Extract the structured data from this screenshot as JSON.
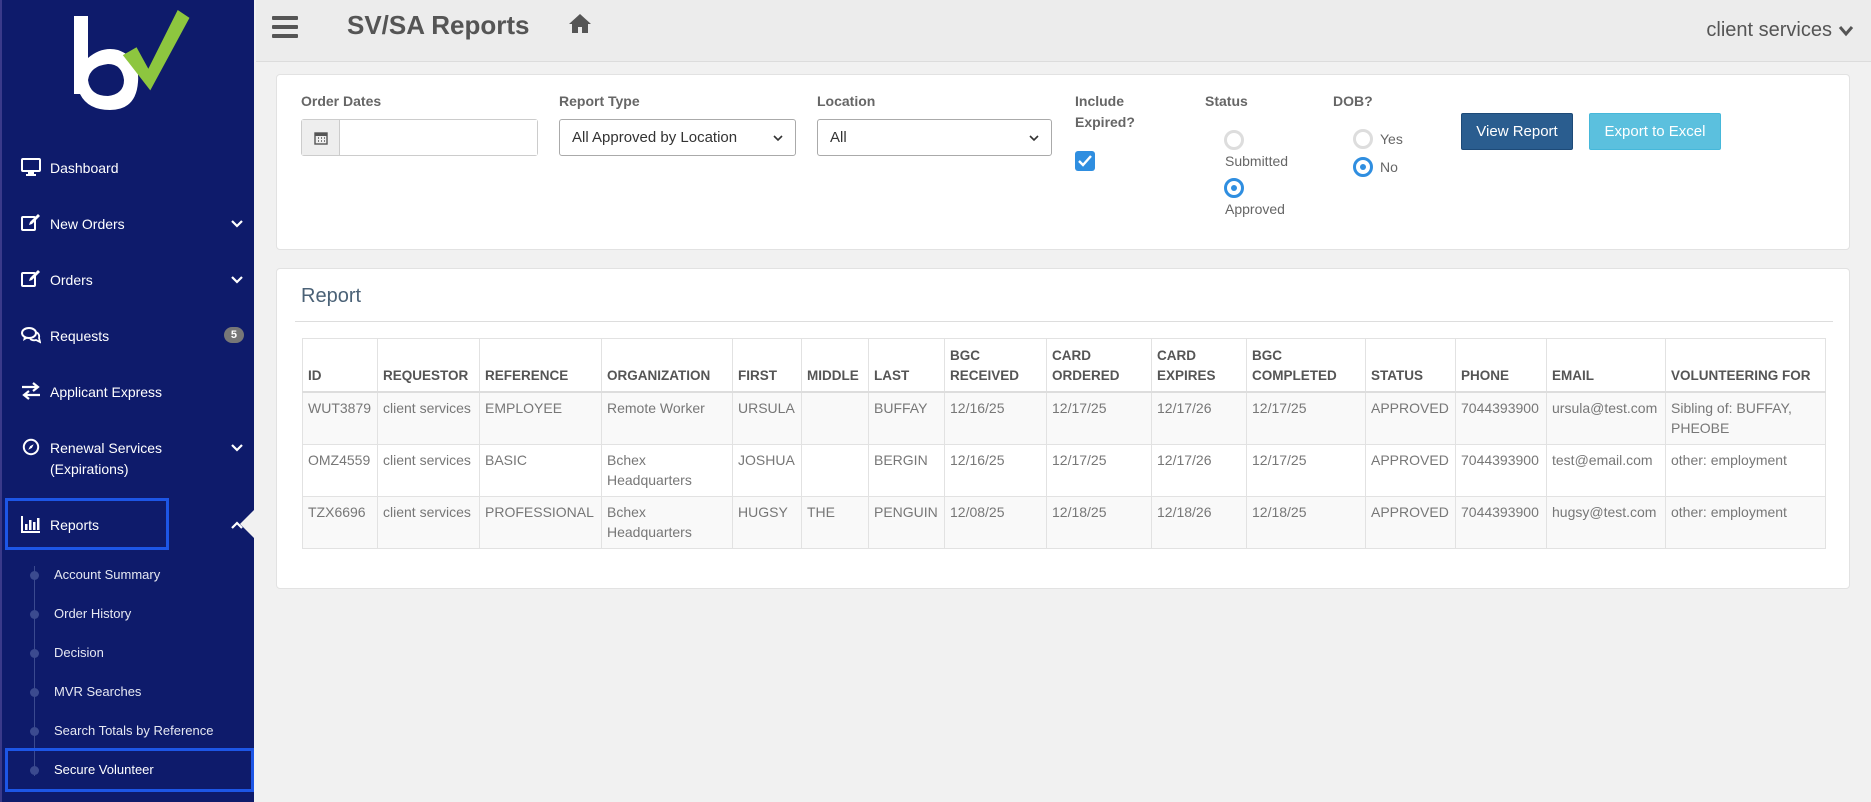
{
  "header": {
    "title": "SV/SA Reports",
    "user": "client services"
  },
  "sidebar": {
    "items": [
      {
        "label": "Dashboard",
        "icon": "monitor-icon"
      },
      {
        "label": "New Orders",
        "icon": "edit-icon"
      },
      {
        "label": "Orders",
        "icon": "edit-icon"
      },
      {
        "label": "Requests",
        "icon": "comments-icon",
        "badge": "5"
      },
      {
        "label": "Applicant Express",
        "icon": "exchange-icon"
      },
      {
        "label": "Renewal Services (Expirations)",
        "icon": "compass-icon"
      },
      {
        "label": "Reports",
        "icon": "bar-chart-icon"
      }
    ],
    "report_subitems": [
      "Account Summary",
      "Order History",
      "Decision",
      "MVR Searches",
      "Search Totals by Reference",
      "Secure Volunteer"
    ]
  },
  "filters": {
    "order_dates_label": "Order Dates",
    "order_dates_value": "",
    "report_type_label": "Report Type",
    "report_type_value": "All Approved by Location",
    "location_label": "Location",
    "location_value": "All",
    "include_expired_label_1": "Include",
    "include_expired_label_2": "Expired?",
    "include_expired_checked": true,
    "status_label": "Status",
    "status_options": [
      "Submitted",
      "Approved"
    ],
    "status_selected": "Approved",
    "dob_label": "DOB?",
    "dob_options": [
      "Yes",
      "No"
    ],
    "dob_selected": "No",
    "view_button": "View Report",
    "export_button": "Export to Excel"
  },
  "report": {
    "title": "Report",
    "columns": [
      "ID",
      "REQUESTOR",
      "REFERENCE",
      "ORGANIZATION",
      "FIRST",
      "MIDDLE",
      "LAST",
      "BGC RECEIVED",
      "CARD ORDERED",
      "CARD EXPIRES",
      "BGC COMPLETED",
      "STATUS",
      "PHONE",
      "EMAIL",
      "VOLUNTEERING FOR"
    ],
    "rows": [
      [
        "WUT3879",
        "client services",
        "EMPLOYEE",
        "Remote Worker",
        "URSULA",
        "",
        "BUFFAY",
        "12/16/25",
        "12/17/25",
        "12/17/26",
        "12/17/25",
        "APPROVED",
        "7044393900",
        "ursula@test.com",
        "Sibling of: BUFFAY, PHEOBE"
      ],
      [
        "OMZ4559",
        "client services",
        "BASIC",
        "Bchex Headquarters",
        "JOSHUA",
        "",
        "BERGIN",
        "12/16/25",
        "12/17/25",
        "12/17/26",
        "12/17/25",
        "APPROVED",
        "7044393900",
        "test@email.com",
        "other: employment"
      ],
      [
        "TZX6696",
        "client services",
        "PROFESSIONAL",
        "Bchex Headquarters",
        "HUGSY",
        "THE",
        "PENGUIN",
        "12/08/25",
        "12/18/25",
        "12/18/26",
        "12/18/25",
        "APPROVED",
        "7044393900",
        "hugsy@test.com",
        "other: employment"
      ]
    ]
  },
  "colors": {
    "sidebar_bg": "#0e1b6b",
    "logo_green": "#8dc63f",
    "primary_button": "#2a5d8f",
    "info_button": "#5bc0de",
    "active_outline": "#1d56e6",
    "radio_checkbox": "#2f8ee0"
  }
}
